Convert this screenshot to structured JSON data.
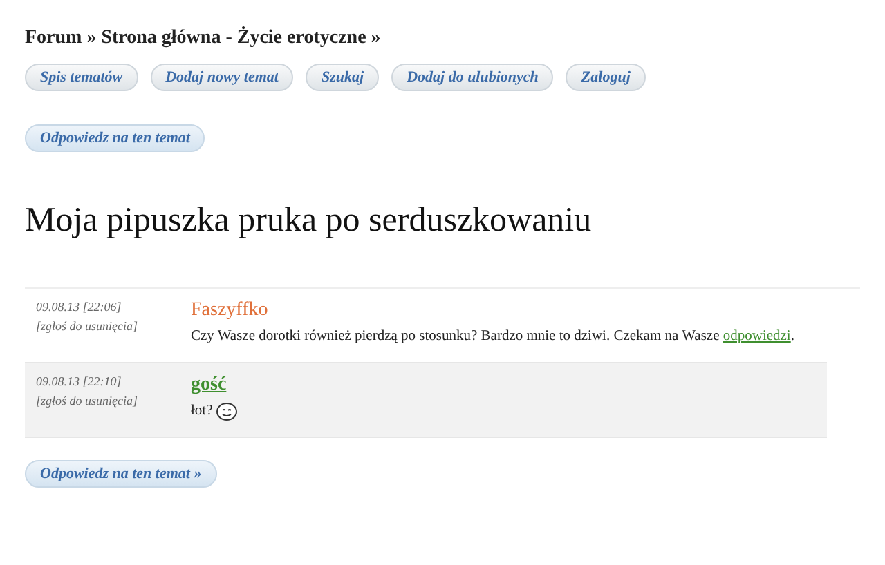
{
  "breadcrumb": "Forum » Strona główna - Życie erotyczne »",
  "nav_buttons": [
    "Spis tematów",
    "Dodaj nowy temat",
    "Szukaj",
    "Dodaj do ulubionych",
    "Zaloguj"
  ],
  "reply_button_top": "Odpowiedz na ten temat",
  "topic_title": "Moja pipuszka pruka po serduszkowaniu",
  "posts": [
    {
      "date": "09.08.13 [22:06]",
      "report": "[zgłoś do usunięcia]",
      "kind": "member",
      "author": "Faszyffko",
      "text": "Czy Wasze dorotki również pierdzą po stosunku? Bardzo mnie to dziwi. Czekam na Wasze ",
      "link": "odpowiedzi",
      "after_link": ".",
      "smiley": false,
      "shaded": false
    },
    {
      "date": "09.08.13 [22:10]",
      "report": "[zgłoś do usunięcia]",
      "kind": "guest",
      "author": "gość",
      "text": "łot?",
      "smiley": true,
      "shaded": true
    }
  ],
  "reply_button_bottom": "Odpowiedz na ten temat »"
}
